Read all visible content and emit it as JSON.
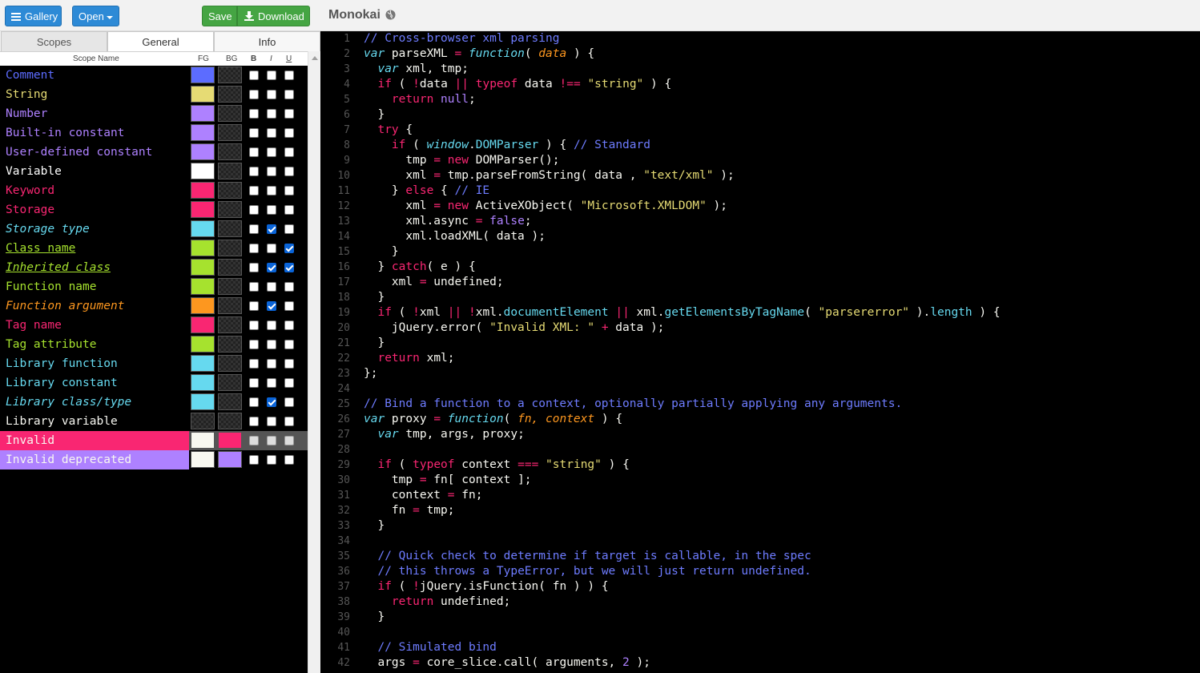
{
  "toolbar": {
    "gallery_label": "Gallery",
    "open_label": "Open",
    "save_label": "Save",
    "download_label": "Download"
  },
  "tabs": [
    "Scopes",
    "General",
    "Info"
  ],
  "columns": {
    "name": "Scope Name",
    "fg": "FG",
    "bg": "BG",
    "b": "B",
    "i": "I",
    "u": "U"
  },
  "theme_title": "Monokai",
  "scopes": [
    {
      "name": "Comment",
      "fg": "#5c6cff",
      "bg": null,
      "b": false,
      "i": false,
      "u": false
    },
    {
      "name": "String",
      "fg": "#e6db74",
      "bg": null,
      "b": false,
      "i": false,
      "u": false
    },
    {
      "name": "Number",
      "fg": "#ae81ff",
      "bg": null,
      "b": false,
      "i": false,
      "u": false
    },
    {
      "name": "Built-in constant",
      "fg": "#ae81ff",
      "bg": null,
      "b": false,
      "i": false,
      "u": false
    },
    {
      "name": "User-defined constant",
      "fg": "#ae81ff",
      "bg": null,
      "b": false,
      "i": false,
      "u": false
    },
    {
      "name": "Variable",
      "fg": "#ffffff",
      "bg": null,
      "b": false,
      "i": false,
      "u": false
    },
    {
      "name": "Keyword",
      "fg": "#f92672",
      "bg": null,
      "b": false,
      "i": false,
      "u": false
    },
    {
      "name": "Storage",
      "fg": "#f92672",
      "bg": null,
      "b": false,
      "i": false,
      "u": false
    },
    {
      "name": "Storage type",
      "fg": "#66d9ef",
      "bg": null,
      "b": false,
      "i": true,
      "u": false
    },
    {
      "name": "Class name",
      "fg": "#a6e22e",
      "bg": null,
      "b": false,
      "i": false,
      "u": true
    },
    {
      "name": "Inherited class",
      "fg": "#a6e22e",
      "bg": null,
      "b": false,
      "i": true,
      "u": true
    },
    {
      "name": "Function name",
      "fg": "#a6e22e",
      "bg": null,
      "b": false,
      "i": false,
      "u": false
    },
    {
      "name": "Function argument",
      "fg": "#fd971f",
      "bg": null,
      "b": false,
      "i": true,
      "u": false
    },
    {
      "name": "Tag name",
      "fg": "#f92672",
      "bg": null,
      "b": false,
      "i": false,
      "u": false
    },
    {
      "name": "Tag attribute",
      "fg": "#a6e22e",
      "bg": null,
      "b": false,
      "i": false,
      "u": false
    },
    {
      "name": "Library function",
      "fg": "#66d9ef",
      "bg": null,
      "b": false,
      "i": false,
      "u": false
    },
    {
      "name": "Library constant",
      "fg": "#66d9ef",
      "bg": null,
      "b": false,
      "i": false,
      "u": false
    },
    {
      "name": "Library class/type",
      "fg": "#66d9ef",
      "bg": null,
      "b": false,
      "i": true,
      "u": false
    },
    {
      "name": "Library variable",
      "fg": null,
      "bg": null,
      "b": false,
      "i": false,
      "u": false
    },
    {
      "name": "Invalid",
      "fg": "#f8f8f0",
      "bg": "#f92672",
      "b": false,
      "i": false,
      "u": false,
      "disabled": true
    },
    {
      "name": "Invalid deprecated",
      "fg": "#f8f8f0",
      "bg": "#ae81ff",
      "b": false,
      "i": false,
      "u": false
    }
  ],
  "colors": {
    "comment": "#6e7cff",
    "string": "#e6db74",
    "number": "#ae81ff",
    "keyword": "#f92672",
    "storage_type": "#66d9ef",
    "function": "#a6e22e",
    "argument": "#fd971f",
    "text": "#f8f8f2",
    "gutter": "#555555"
  },
  "code_lines": [
    [
      [
        "c",
        "// Cross-browser xml parsing"
      ]
    ],
    [
      [
        "st",
        "var"
      ],
      [
        "t",
        " parseXML "
      ],
      [
        "k",
        "="
      ],
      [
        "t",
        " "
      ],
      [
        "st",
        "function"
      ],
      [
        "t",
        "( "
      ],
      [
        "a",
        "data"
      ],
      [
        "t",
        " ) {"
      ]
    ],
    [
      [
        "t",
        "  "
      ],
      [
        "st",
        "var"
      ],
      [
        "t",
        " xml, tmp;"
      ]
    ],
    [
      [
        "t",
        "  "
      ],
      [
        "k",
        "if"
      ],
      [
        "t",
        " ( "
      ],
      [
        "k",
        "!"
      ],
      [
        "t",
        "data "
      ],
      [
        "k",
        "||"
      ],
      [
        "t",
        " "
      ],
      [
        "k",
        "typeof"
      ],
      [
        "t",
        " data "
      ],
      [
        "k",
        "!=="
      ],
      [
        "t",
        " "
      ],
      [
        "s",
        "\"string\""
      ],
      [
        "t",
        " ) {"
      ]
    ],
    [
      [
        "t",
        "    "
      ],
      [
        "k",
        "return"
      ],
      [
        "t",
        " "
      ],
      [
        "n",
        "null"
      ],
      [
        "t",
        ";"
      ]
    ],
    [
      [
        "t",
        "  }"
      ]
    ],
    [
      [
        "t",
        "  "
      ],
      [
        "k",
        "try"
      ],
      [
        "t",
        " {"
      ]
    ],
    [
      [
        "t",
        "    "
      ],
      [
        "k",
        "if"
      ],
      [
        "t",
        " ( "
      ],
      [
        "sti",
        "window"
      ],
      [
        "t",
        "."
      ],
      [
        "lf",
        "DOMParser"
      ],
      [
        "t",
        " ) { "
      ],
      [
        "c",
        "// Standard"
      ]
    ],
    [
      [
        "t",
        "      tmp "
      ],
      [
        "k",
        "="
      ],
      [
        "t",
        " "
      ],
      [
        "k",
        "new"
      ],
      [
        "t",
        " DOMParser();"
      ]
    ],
    [
      [
        "t",
        "      xml "
      ],
      [
        "k",
        "="
      ],
      [
        "t",
        " tmp.parseFromString( data , "
      ],
      [
        "s",
        "\"text/xml\""
      ],
      [
        "t",
        " );"
      ]
    ],
    [
      [
        "t",
        "    } "
      ],
      [
        "k",
        "else"
      ],
      [
        "t",
        " { "
      ],
      [
        "c",
        "// IE"
      ]
    ],
    [
      [
        "t",
        "      xml "
      ],
      [
        "k",
        "="
      ],
      [
        "t",
        " "
      ],
      [
        "k",
        "new"
      ],
      [
        "t",
        " ActiveXObject( "
      ],
      [
        "s",
        "\"Microsoft.XMLDOM\""
      ],
      [
        "t",
        " );"
      ]
    ],
    [
      [
        "t",
        "      xml.async "
      ],
      [
        "k",
        "="
      ],
      [
        "t",
        " "
      ],
      [
        "n",
        "false"
      ],
      [
        "t",
        ";"
      ]
    ],
    [
      [
        "t",
        "      xml.loadXML( data );"
      ]
    ],
    [
      [
        "t",
        "    }"
      ]
    ],
    [
      [
        "t",
        "  } "
      ],
      [
        "k",
        "catch"
      ],
      [
        "t",
        "( e ) {"
      ]
    ],
    [
      [
        "t",
        "    xml "
      ],
      [
        "k",
        "="
      ],
      [
        "t",
        " undefined;"
      ]
    ],
    [
      [
        "t",
        "  }"
      ]
    ],
    [
      [
        "t",
        "  "
      ],
      [
        "k",
        "if"
      ],
      [
        "t",
        " ( "
      ],
      [
        "k",
        "!"
      ],
      [
        "t",
        "xml "
      ],
      [
        "k",
        "||"
      ],
      [
        "t",
        " "
      ],
      [
        "k",
        "!"
      ],
      [
        "t",
        "xml."
      ],
      [
        "lf",
        "documentElement"
      ],
      [
        "t",
        " "
      ],
      [
        "k",
        "||"
      ],
      [
        "t",
        " xml."
      ],
      [
        "lf",
        "getElementsByTagName"
      ],
      [
        "t",
        "( "
      ],
      [
        "s",
        "\"parsererror\""
      ],
      [
        "t",
        " )."
      ],
      [
        "lf",
        "length"
      ],
      [
        "t",
        " ) {"
      ]
    ],
    [
      [
        "t",
        "    jQuery.error( "
      ],
      [
        "s",
        "\"Invalid XML: \""
      ],
      [
        "t",
        " "
      ],
      [
        "k",
        "+"
      ],
      [
        "t",
        " data );"
      ]
    ],
    [
      [
        "t",
        "  }"
      ]
    ],
    [
      [
        "t",
        "  "
      ],
      [
        "k",
        "return"
      ],
      [
        "t",
        " xml;"
      ]
    ],
    [
      [
        "t",
        "};"
      ]
    ],
    [],
    [
      [
        "c",
        "// Bind a function to a context, optionally partially applying any arguments."
      ]
    ],
    [
      [
        "st",
        "var"
      ],
      [
        "t",
        " proxy "
      ],
      [
        "k",
        "="
      ],
      [
        "t",
        " "
      ],
      [
        "st",
        "function"
      ],
      [
        "t",
        "( "
      ],
      [
        "a",
        "fn, context"
      ],
      [
        "t",
        " ) {"
      ]
    ],
    [
      [
        "t",
        "  "
      ],
      [
        "st",
        "var"
      ],
      [
        "t",
        " tmp, args, proxy;"
      ]
    ],
    [],
    [
      [
        "t",
        "  "
      ],
      [
        "k",
        "if"
      ],
      [
        "t",
        " ( "
      ],
      [
        "k",
        "typeof"
      ],
      [
        "t",
        " context "
      ],
      [
        "k",
        "==="
      ],
      [
        "t",
        " "
      ],
      [
        "s",
        "\"string\""
      ],
      [
        "t",
        " ) {"
      ]
    ],
    [
      [
        "t",
        "    tmp "
      ],
      [
        "k",
        "="
      ],
      [
        "t",
        " fn[ context ];"
      ]
    ],
    [
      [
        "t",
        "    context "
      ],
      [
        "k",
        "="
      ],
      [
        "t",
        " fn;"
      ]
    ],
    [
      [
        "t",
        "    fn "
      ],
      [
        "k",
        "="
      ],
      [
        "t",
        " tmp;"
      ]
    ],
    [
      [
        "t",
        "  }"
      ]
    ],
    [],
    [
      [
        "t",
        "  "
      ],
      [
        "c",
        "// Quick check to determine if target is callable, in the spec"
      ]
    ],
    [
      [
        "t",
        "  "
      ],
      [
        "c",
        "// this throws a TypeError, but we will just return undefined."
      ]
    ],
    [
      [
        "t",
        "  "
      ],
      [
        "k",
        "if"
      ],
      [
        "t",
        " ( "
      ],
      [
        "k",
        "!"
      ],
      [
        "t",
        "jQuery.isFunction( fn ) ) {"
      ]
    ],
    [
      [
        "t",
        "    "
      ],
      [
        "k",
        "return"
      ],
      [
        "t",
        " undefined;"
      ]
    ],
    [
      [
        "t",
        "  }"
      ]
    ],
    [],
    [
      [
        "t",
        "  "
      ],
      [
        "c",
        "// Simulated bind"
      ]
    ],
    [
      [
        "t",
        "  args "
      ],
      [
        "k",
        "="
      ],
      [
        "t",
        " core_slice.call( arguments, "
      ],
      [
        "n",
        "2"
      ],
      [
        "t",
        " );"
      ]
    ]
  ]
}
